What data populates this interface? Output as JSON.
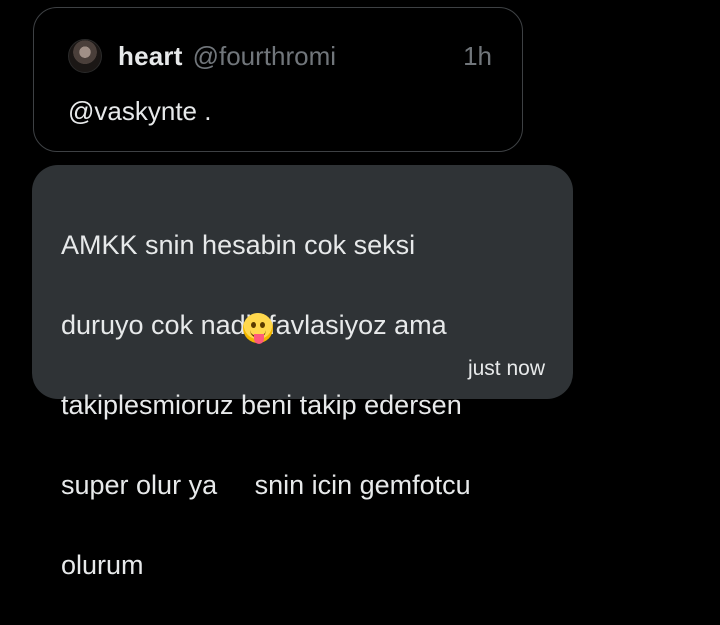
{
  "quoted_post": {
    "display_name": "heart",
    "handle": "@fourthromi",
    "time": "1h",
    "text": "@vaskynte ."
  },
  "message": {
    "lines": [
      "AMKK snin hesabin cok seksi",
      "duruyo cok nadir favlasiyoz ama",
      "takiplesmioruz beni takip edersen",
      "super olur ya     snin icin gemfotcu",
      "olurum"
    ],
    "emoji": "face-with-tongue-icon",
    "timestamp": "just now"
  },
  "colors": {
    "background": "#000000",
    "bubble": "#2f3336",
    "muted": "#71767b",
    "text": "#e7e9ea"
  }
}
